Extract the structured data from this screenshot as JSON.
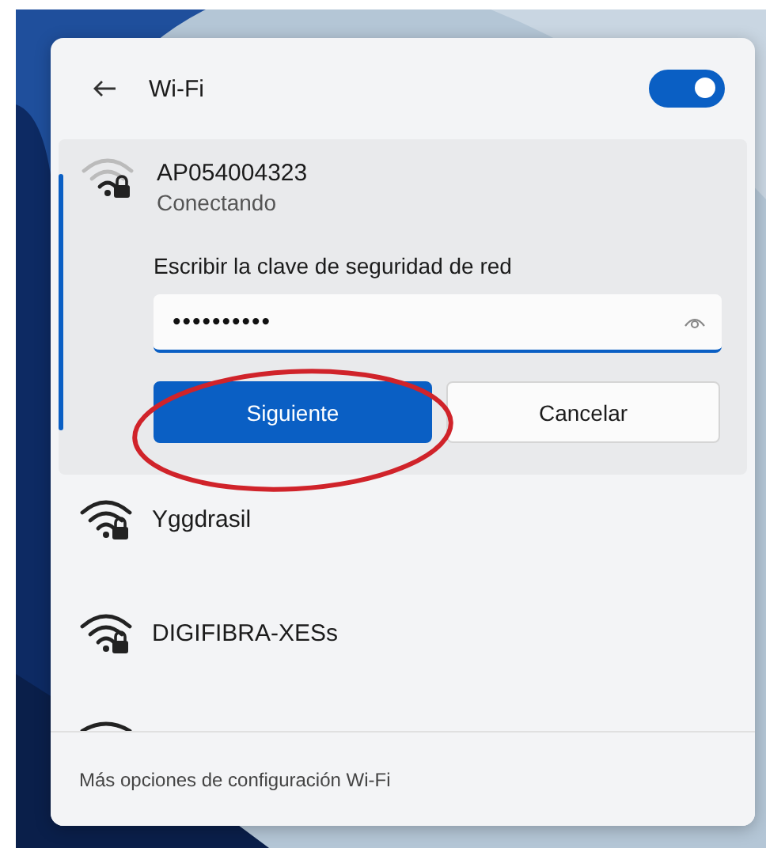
{
  "header": {
    "title": "Wi-Fi",
    "wifi_on": true
  },
  "connecting": {
    "name": "AP054004323",
    "status": "Conectando",
    "password_label": "Escribir la clave de seguridad de red",
    "password_value": "••••••••••",
    "secured": true
  },
  "buttons": [
    {
      "label": "Siguiente",
      "kind": "primary"
    },
    {
      "label": "Cancelar",
      "kind": "secondary"
    }
  ],
  "networks": [
    {
      "name": "Yggdrasil",
      "secured": true
    },
    {
      "name": "DIGIFIBRA-XESs",
      "secured": true
    }
  ],
  "footer": {
    "link": "Más opciones de configuración Wi-Fi"
  }
}
